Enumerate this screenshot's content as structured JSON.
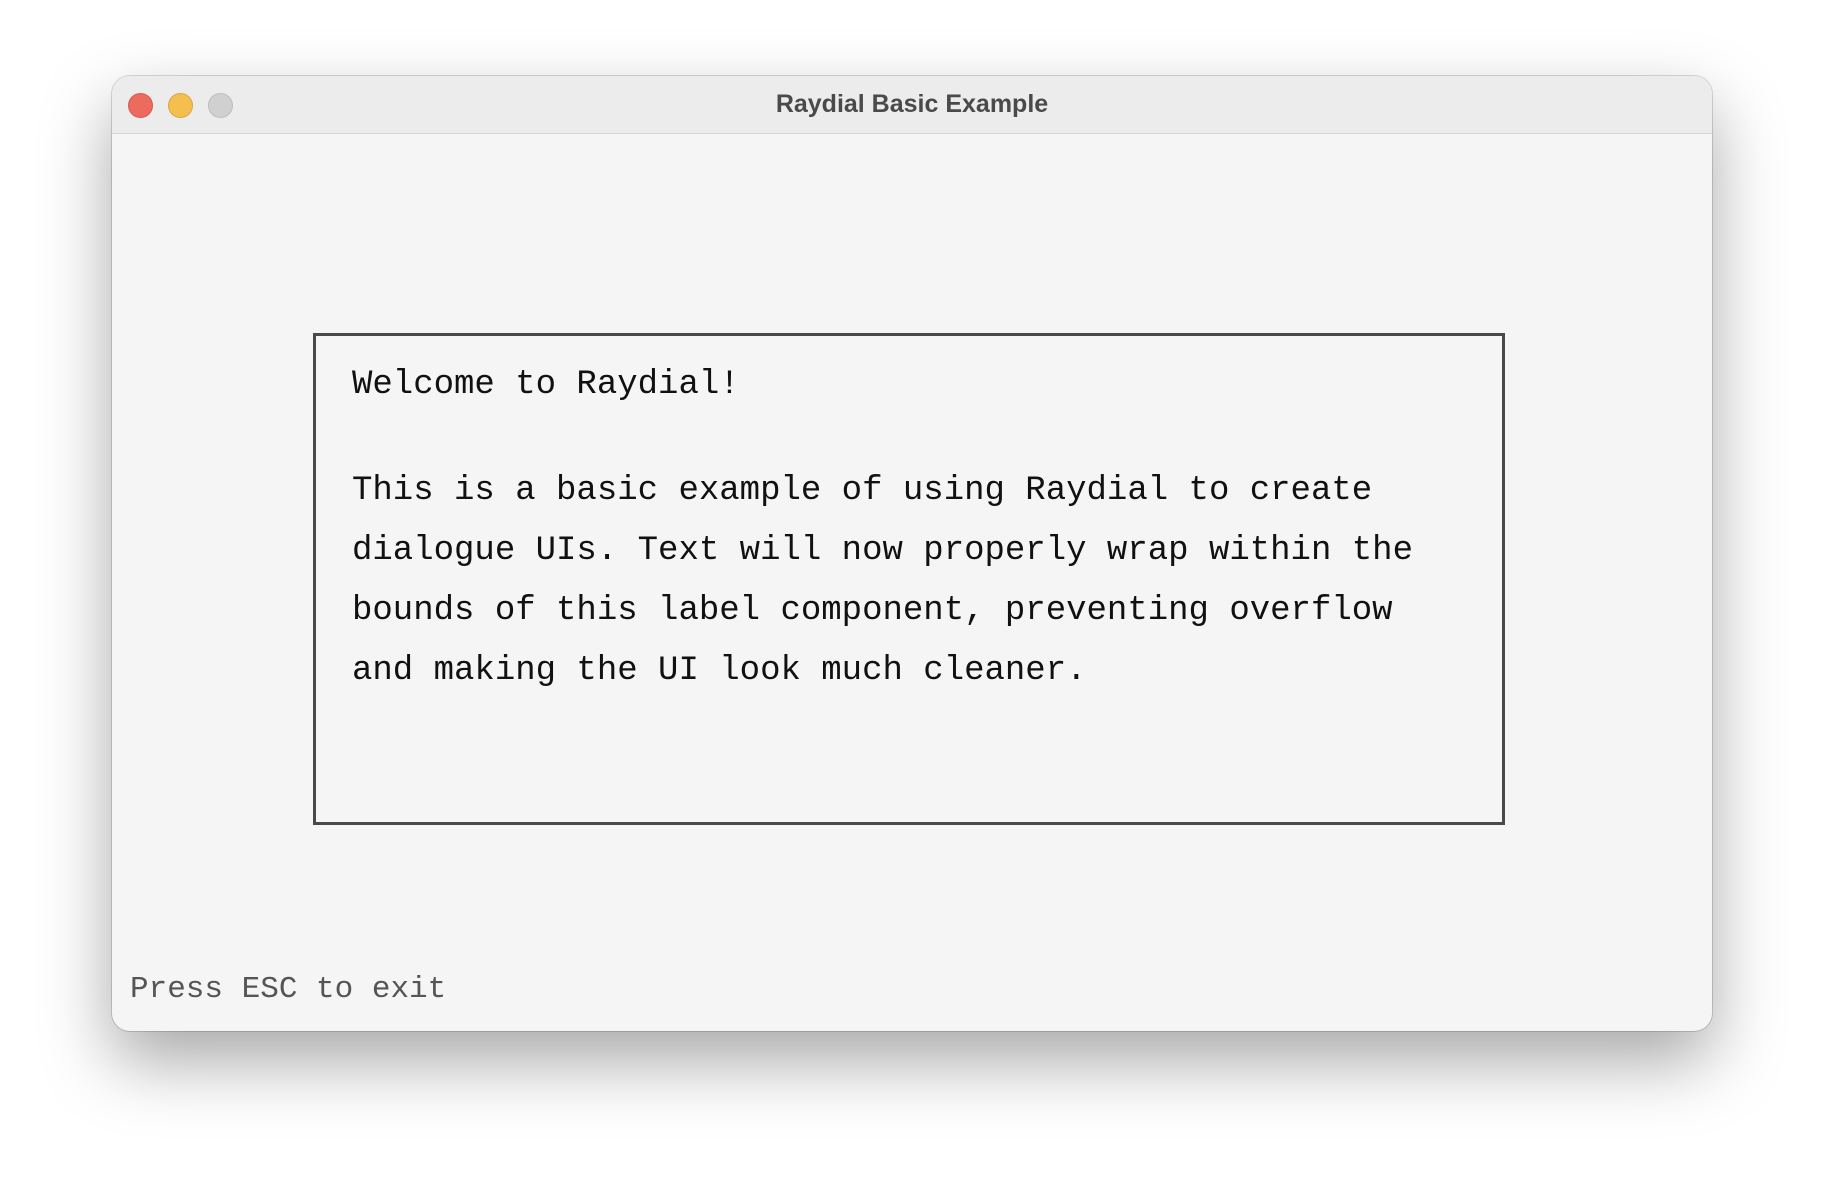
{
  "window": {
    "title": "Raydial Basic Example"
  },
  "dialog": {
    "heading": "Welcome to Raydial!",
    "body": "This is a basic example of using Raydial to create dialogue UIs. Text will now properly wrap within the bounds of this label component, preventing overflow and making the UI look much cleaner."
  },
  "footer": {
    "hint": "Press ESC to exit"
  },
  "colors": {
    "close": "#ed6a5e",
    "minimize": "#f5bf4f",
    "maximize": "#d0d0d0",
    "border": "#4a4a4a"
  }
}
